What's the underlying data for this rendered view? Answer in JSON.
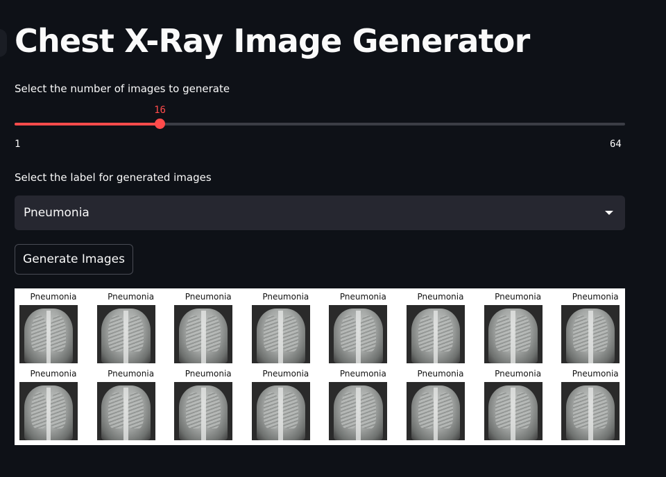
{
  "title": "Chest X-Ray Image Generator",
  "slider": {
    "label": "Select the number of images to generate",
    "value": 16,
    "value_text": "16",
    "min": 1,
    "max": 64,
    "min_text": "1",
    "max_text": "64",
    "accent_color": "#ff4b4b"
  },
  "label_select": {
    "label": "Select the label for generated images",
    "value": "Pneumonia"
  },
  "generate_button": {
    "label": "Generate Images"
  },
  "images": {
    "captions": [
      "Pneumonia",
      "Pneumonia",
      "Pneumonia",
      "Pneumonia",
      "Pneumonia",
      "Pneumonia",
      "Pneumonia",
      "Pneumonia",
      "Pneumonia",
      "Pneumonia",
      "Pneumonia",
      "Pneumonia",
      "Pneumonia",
      "Pneumonia",
      "Pneumonia",
      "Pneumonia"
    ]
  },
  "colors": {
    "background": "#0e1117",
    "select_background": "#262730",
    "text": "#fafafa"
  }
}
